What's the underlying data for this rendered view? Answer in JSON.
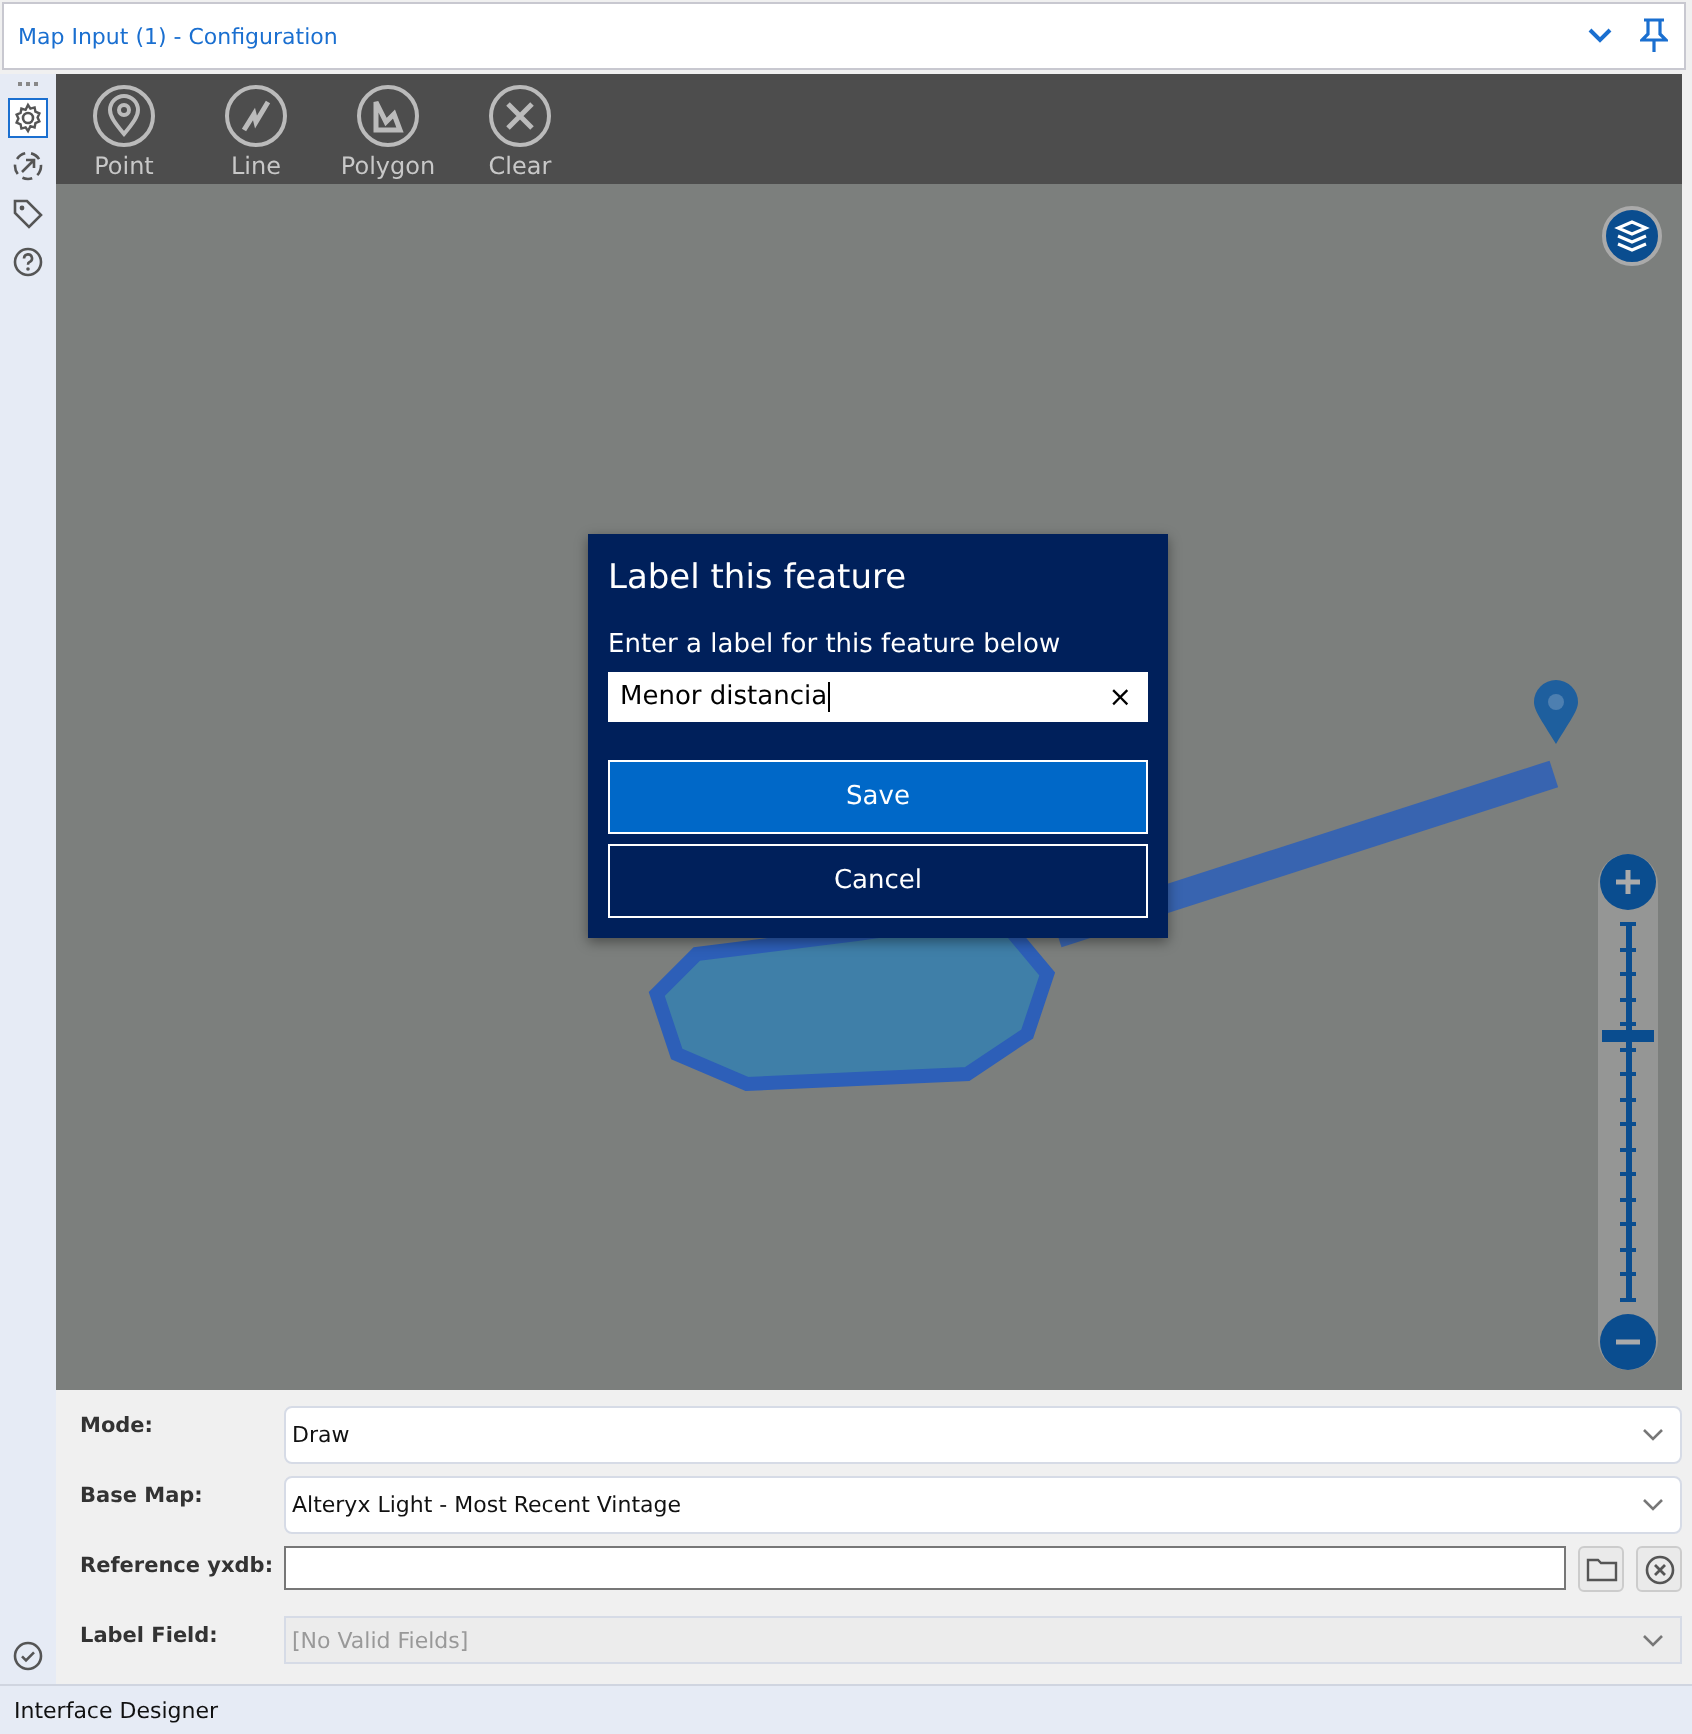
{
  "window": {
    "title": "Map Input (1) - Configuration"
  },
  "sidebar": {
    "tools": [
      {
        "kind": "settings",
        "selected": true
      },
      {
        "kind": "connection",
        "selected": false
      },
      {
        "kind": "tag",
        "selected": false
      },
      {
        "kind": "help",
        "selected": false
      }
    ]
  },
  "map": {
    "toolbar": [
      {
        "kind": "point",
        "label": "Point"
      },
      {
        "kind": "line",
        "label": "Line"
      },
      {
        "kind": "polygon",
        "label": "Polygon"
      },
      {
        "kind": "clear",
        "label": "Clear"
      }
    ],
    "zoom": {
      "level": 0.7
    },
    "dialog": {
      "title": "Label this feature",
      "prompt": "Enter a label for this feature below",
      "value": "Menor distancia",
      "clear": "×",
      "buttons": [
        {
          "label": "Save",
          "kind": "primary"
        },
        {
          "label": "Cancel",
          "kind": "secondary"
        }
      ]
    }
  },
  "form": {
    "rows": [
      {
        "label": "Mode:",
        "kind": "dropdown",
        "value": "Draw",
        "disabled": false
      },
      {
        "label": "Base Map:",
        "kind": "dropdown",
        "value": "Alteryx Light - Most Recent Vintage",
        "disabled": false
      },
      {
        "label": "Reference yxdb:",
        "kind": "file"
      },
      {
        "label": "Label Field:",
        "kind": "dropdown",
        "value": "[No Valid Fields]",
        "disabled": true
      }
    ]
  },
  "status_bar": {
    "text": "Interface Designer"
  }
}
